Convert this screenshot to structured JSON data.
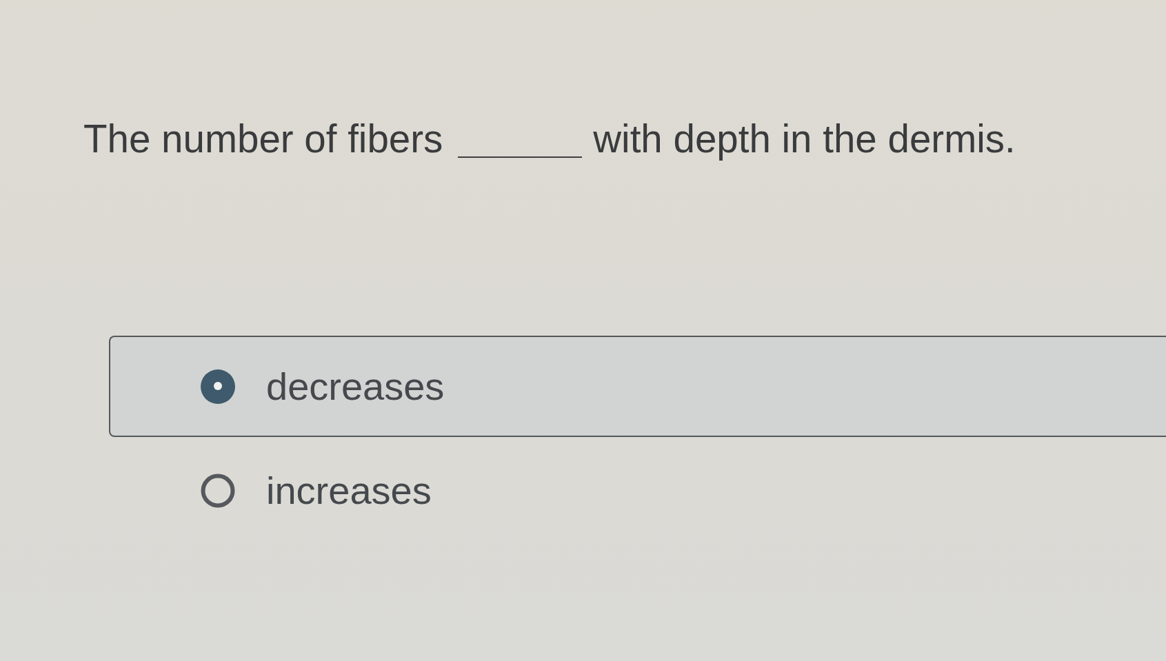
{
  "question": {
    "text_before": "The number of fibers",
    "text_after": "with depth in the dermis."
  },
  "options": [
    {
      "label": "decreases",
      "selected": true
    },
    {
      "label": "increases",
      "selected": false
    }
  ]
}
